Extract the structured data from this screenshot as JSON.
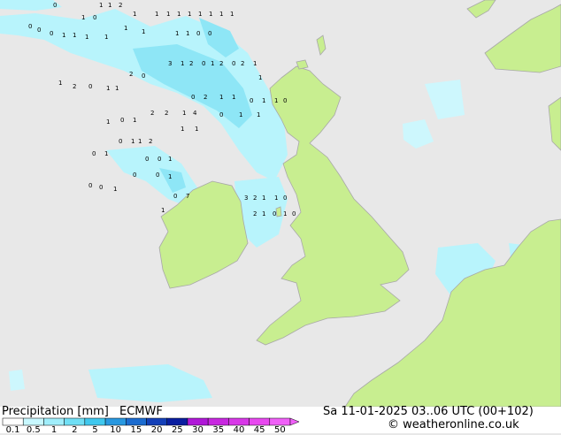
{
  "title": "Precipitation [mm]",
  "model": "ECMWF",
  "valid_time": "Sa 11-01-2025 03..06 UTC (00+102)",
  "credit": "© weatheronline.co.uk",
  "colors": {
    "sea": "#e8e8e8",
    "land": "#c8ee90",
    "coast": "#a8a8a8",
    "precip_light": "#b8f4fc",
    "precip_mid": "#8ee6f6"
  },
  "legend": {
    "labels": [
      "0.1",
      "0.5",
      "1",
      "2",
      "5",
      "10",
      "15",
      "20",
      "25",
      "30",
      "35",
      "40",
      "45",
      "50"
    ],
    "colors": [
      "#ffffff",
      "#c8f8ff",
      "#a0eefb",
      "#70dff5",
      "#40c8ee",
      "#2898e0",
      "#1c6cd0",
      "#1440b8",
      "#0a1ea0",
      "#b018d8",
      "#c828e0",
      "#d838e8",
      "#e848f0",
      "#f060f8"
    ]
  },
  "map_labels": [
    "1",
    "1",
    "2",
    "1",
    "0",
    "1",
    "1",
    "1",
    "1",
    "1",
    "1",
    "1",
    "1",
    "1",
    "0",
    "0",
    "0",
    "0",
    "1",
    "1",
    "1",
    "1",
    "1",
    "1",
    "1",
    "1",
    "0",
    "0",
    "3",
    "1",
    "2",
    "0",
    "1",
    "2",
    "0",
    "2",
    "1",
    "1",
    "0",
    "2",
    "1",
    "1",
    "0",
    "2",
    "1",
    "0",
    "2",
    "1",
    "1",
    "0",
    "1",
    "1",
    "0",
    "4",
    "1",
    "2",
    "2",
    "1",
    "0",
    "1",
    "1",
    "1",
    "0",
    "1",
    "1",
    "2",
    "1",
    "1",
    "0",
    "1",
    "0",
    "0",
    "0",
    "1",
    "0",
    "1",
    "0",
    "0",
    "0",
    "1",
    "1",
    "0",
    "7",
    "3",
    "2",
    "1",
    "1",
    "0",
    "2",
    "1",
    "0",
    "1",
    "0"
  ]
}
